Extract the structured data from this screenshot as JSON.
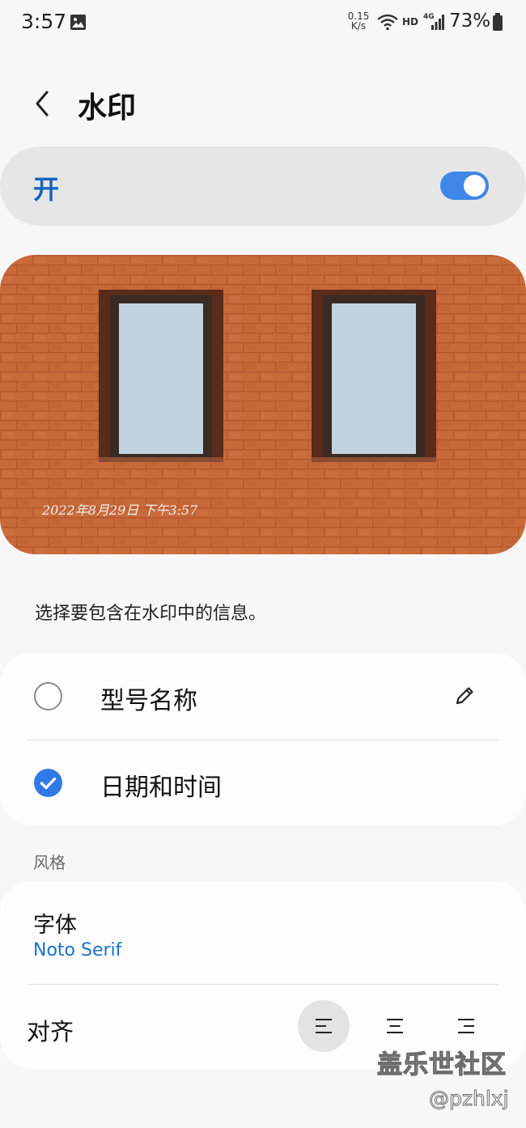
{
  "status_bar": {
    "time": "3:57",
    "net_speed_value": "0.15",
    "net_speed_unit": "K/s",
    "hd": "HD",
    "network": "4G",
    "battery": "73%"
  },
  "header": {
    "title": "水印"
  },
  "master_switch": {
    "label": "开",
    "on": true,
    "accent": "#3f87e8"
  },
  "preview": {
    "watermark_text": "2022年8月29日 下午3:57"
  },
  "info_hint": "选择要包含在水印中的信息。",
  "options": [
    {
      "label": "型号名称",
      "checked": false
    },
    {
      "label": "日期和时间",
      "checked": true
    }
  ],
  "style_section": {
    "label": "风格",
    "font_title": "字体",
    "font_value": "Noto Serif",
    "align_label": "对齐",
    "align_selected": "left"
  },
  "overlay": {
    "site": "盖乐世社区",
    "user": "@pzhlxj"
  }
}
